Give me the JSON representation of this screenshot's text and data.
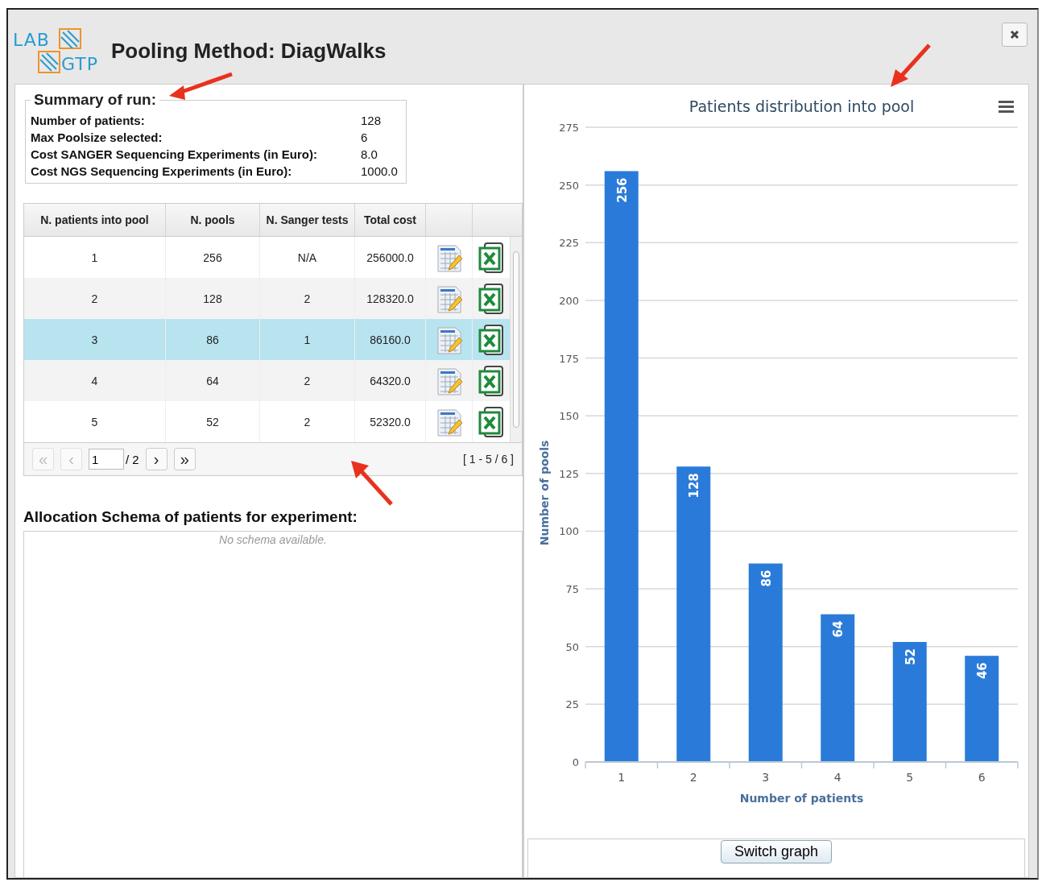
{
  "window": {
    "title": "Pooling Method: DiagWalks",
    "logo": {
      "top": "LAB",
      "bottom": "GTP"
    }
  },
  "summary": {
    "legend": "Summary of run:",
    "items": [
      {
        "label": "Number of patients:",
        "value": "128"
      },
      {
        "label": "Max Poolsize selected:",
        "value": "6"
      },
      {
        "label": "Cost SANGER Sequencing Experiments (in Euro):",
        "value": "8.0"
      },
      {
        "label": "Cost NGS Sequencing Experiments (in Euro):",
        "value": "1000.0"
      }
    ]
  },
  "table": {
    "columns": [
      "N. patients into pool",
      "N. pools",
      "N. Sanger tests",
      "Total cost"
    ],
    "rows": [
      {
        "cells": [
          "1",
          "256",
          "N/A",
          "256000.0"
        ],
        "selected": false
      },
      {
        "cells": [
          "2",
          "128",
          "2",
          "128320.0"
        ],
        "selected": false
      },
      {
        "cells": [
          "3",
          "86",
          "1",
          "86160.0"
        ],
        "selected": true
      },
      {
        "cells": [
          "4",
          "64",
          "2",
          "64320.0"
        ],
        "selected": false
      },
      {
        "cells": [
          "5",
          "52",
          "2",
          "52320.0"
        ],
        "selected": false
      }
    ]
  },
  "pager": {
    "first": {
      "label": "«",
      "disabled": true
    },
    "prev": {
      "label": "‹",
      "disabled": true
    },
    "page": "1",
    "total": "/ 2",
    "next": {
      "label": "›",
      "disabled": false
    },
    "last": {
      "label": "»",
      "disabled": false
    },
    "range": "[ 1 - 5 / 6 ]"
  },
  "allocation": {
    "title": "Allocation Schema of patients for experiment:",
    "empty": "No schema available."
  },
  "chart": {
    "chart_data": {
      "type": "bar",
      "title": "Patients distribution into pool",
      "xlabel": "Number of patients",
      "ylabel": "Number of pools",
      "categories": [
        "1",
        "2",
        "3",
        "4",
        "5",
        "6"
      ],
      "series": [
        {
          "color": "#2a7bd9",
          "values": [
            256,
            128,
            86,
            64,
            52,
            46
          ]
        }
      ],
      "ylim": [
        0,
        275
      ],
      "yticks": [
        0,
        25,
        50,
        75,
        100,
        125,
        150,
        175,
        200,
        225,
        250,
        275
      ],
      "data_labels": true,
      "grid": true
    }
  },
  "switch_button": "Switch graph"
}
